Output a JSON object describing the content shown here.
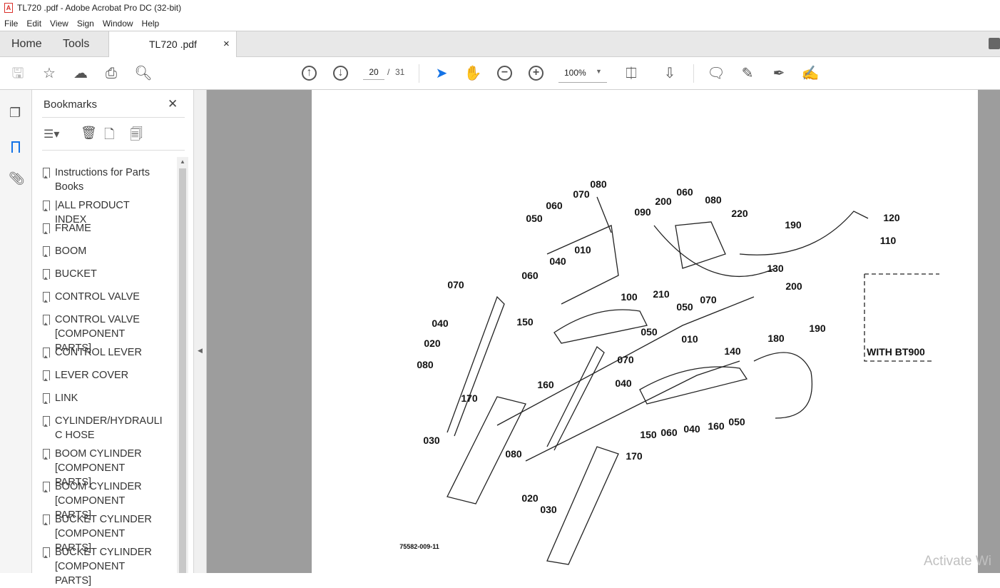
{
  "window": {
    "title": "TL720 .pdf - Adobe Acrobat Pro DC (32-bit)"
  },
  "menu": [
    "File",
    "Edit",
    "View",
    "Sign",
    "Window",
    "Help"
  ],
  "tabs": {
    "home": "Home",
    "tools": "Tools",
    "document": "TL720 .pdf",
    "close": "×"
  },
  "toolbar": {
    "page_current": "20",
    "page_sep": "/",
    "page_total": "31",
    "zoom": "100%"
  },
  "bookmarks": {
    "title": "Bookmarks",
    "close": "✕",
    "items": [
      "Instructions for Parts Books",
      "|ALL PRODUCT INDEX",
      "FRAME",
      "BOOM",
      "BUCKET",
      "CONTROL VALVE",
      "CONTROL VALVE [COMPONENT PARTS]",
      "CONTROL LEVER",
      "LEVER COVER",
      "LINK",
      "CYLINDER/HYDRAULI C HOSE",
      "BOOM CYLINDER [COMPONENT PARTS]",
      "BOOM CYLINDER [COMPONENT PARTS]",
      "BUCKET CYLINDER [COMPONENT PARTS]",
      "BUCKET CYLINDER [COMPONENT PARTS]"
    ]
  },
  "drawing": {
    "labels": [
      "080",
      "070",
      "060",
      "050",
      "090",
      "200",
      "060",
      "080",
      "220",
      "190",
      "120",
      "110",
      "010",
      "040",
      "060",
      "130",
      "100",
      "210",
      "050",
      "070",
      "200",
      "190",
      "070",
      "150",
      "050",
      "040",
      "020",
      "010",
      "180",
      "140",
      "070",
      "080",
      "160",
      "040",
      "170",
      "030",
      "080",
      "150",
      "060",
      "040",
      "160",
      "050",
      "170",
      "020",
      "030"
    ],
    "option_label": "WITH BT900",
    "drawing_number": "75582-009-11"
  },
  "watermark": "Activate Wi",
  "colors": {
    "accent": "#1473e6",
    "viewer_bg": "#9d9d9d",
    "pdf_icon": "#d9302b"
  }
}
